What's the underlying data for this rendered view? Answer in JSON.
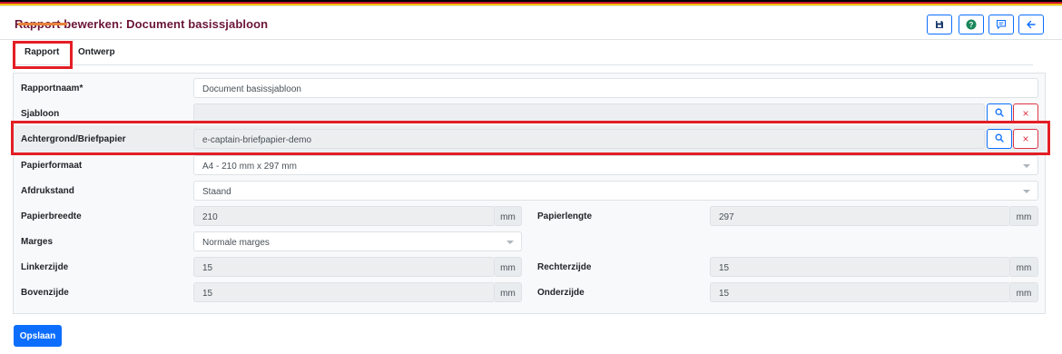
{
  "header": {
    "title": "Rapport bewerken: Document basissjabloon",
    "buttons": {
      "save_icon": "save-icon",
      "help_icon": "help-icon",
      "comment_icon": "comment-icon",
      "back_icon": "arrow-left-icon"
    }
  },
  "tabs": [
    {
      "label": "Rapport",
      "active": true
    },
    {
      "label": "Ontwerp",
      "active": false
    }
  ],
  "form": {
    "rapportnaam": {
      "label": "Rapportnaam*",
      "value": "Document basissjabloon"
    },
    "sjabloon": {
      "label": "Sjabloon",
      "value": ""
    },
    "achtergrond": {
      "label": "Achtergrond/Briefpapier",
      "value": "e-captain-briefpapier-demo"
    },
    "papierformaat": {
      "label": "Papierformaat",
      "value": "A4 - 210 mm x 297 mm"
    },
    "afdrukstand": {
      "label": "Afdrukstand",
      "value": "Staand"
    },
    "papierbreedte": {
      "label": "Papierbreedte",
      "value": "210",
      "unit": "mm"
    },
    "papierlengte": {
      "label": "Papierlengte",
      "value": "297",
      "unit": "mm"
    },
    "marges": {
      "label": "Marges",
      "value": "Normale marges"
    },
    "linkerzijde": {
      "label": "Linkerzijde",
      "value": "15",
      "unit": "mm"
    },
    "rechterzijde": {
      "label": "Rechterzijde",
      "value": "15",
      "unit": "mm"
    },
    "bovenzijde": {
      "label": "Bovenzijde",
      "value": "15",
      "unit": "mm"
    },
    "onderzijde": {
      "label": "Onderzijde",
      "value": "15",
      "unit": "mm"
    }
  },
  "actions": {
    "search_icon": "search-icon",
    "clear_label": "×"
  },
  "footer": {
    "save_label": "Opslaan"
  },
  "colors": {
    "accent": "#0d6efd",
    "title": "#6b1537",
    "highlight": "#e31e24",
    "tab_underline": "#e8833a",
    "danger": "#dc3545"
  }
}
